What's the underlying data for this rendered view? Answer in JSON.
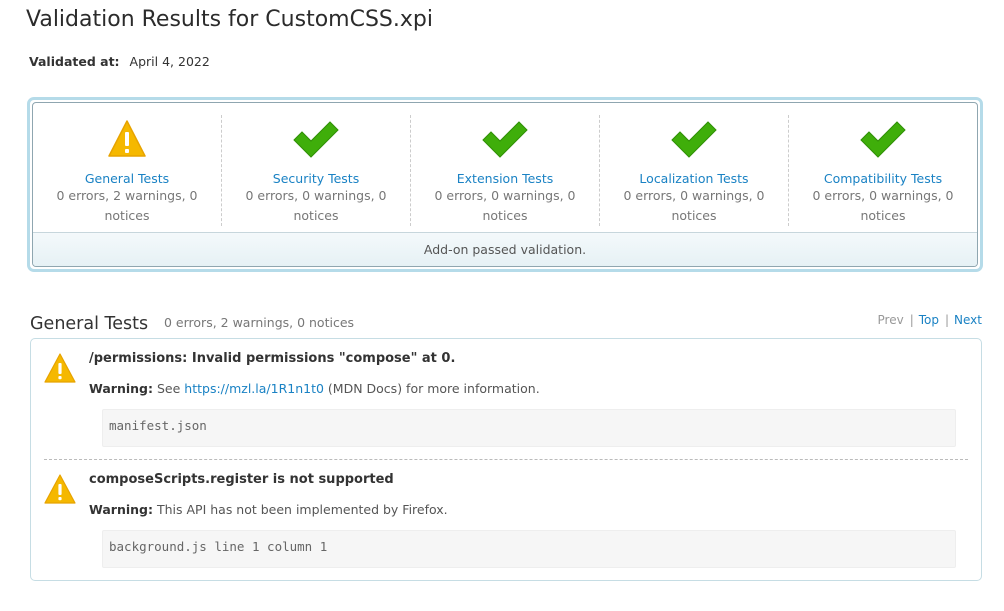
{
  "title": "Validation Results for CustomCSS.xpi",
  "validated": {
    "label": "Validated at:",
    "date": "April 4, 2022"
  },
  "summary": {
    "categories": [
      {
        "name": "General Tests",
        "counts": "0 errors, 2 warnings, 0 notices",
        "icon": "warning-icon"
      },
      {
        "name": "Security Tests",
        "counts": "0 errors, 0 warnings, 0 notices",
        "icon": "check-icon"
      },
      {
        "name": "Extension Tests",
        "counts": "0 errors, 0 warnings, 0 notices",
        "icon": "check-icon"
      },
      {
        "name": "Localization Tests",
        "counts": "0 errors, 0 warnings, 0 notices",
        "icon": "check-icon"
      },
      {
        "name": "Compatibility Tests",
        "counts": "0 errors, 0 warnings, 0 notices",
        "icon": "check-icon"
      }
    ],
    "banner": "Add-on passed validation."
  },
  "section": {
    "title": "General Tests",
    "counts": "0 errors, 2 warnings, 0 notices",
    "nav": {
      "prev": "Prev",
      "top": "Top",
      "next": "Next"
    }
  },
  "messages": [
    {
      "title": "/permissions: Invalid permissions \"compose\" at 0.",
      "label": "Warning:",
      "pre": "See",
      "link": "https://mzl.la/1R1n1t0",
      "post": "(MDN Docs) for more information.",
      "file": "manifest.json"
    },
    {
      "title": "composeScripts.register is not supported",
      "label": "Warning:",
      "text": "This API has not been implemented by Firefox.",
      "file": "background.js line 1 column 1"
    }
  ],
  "colors": {
    "link": "#1a82c4",
    "check": "#3fae0a",
    "warning": "#f5b800"
  }
}
